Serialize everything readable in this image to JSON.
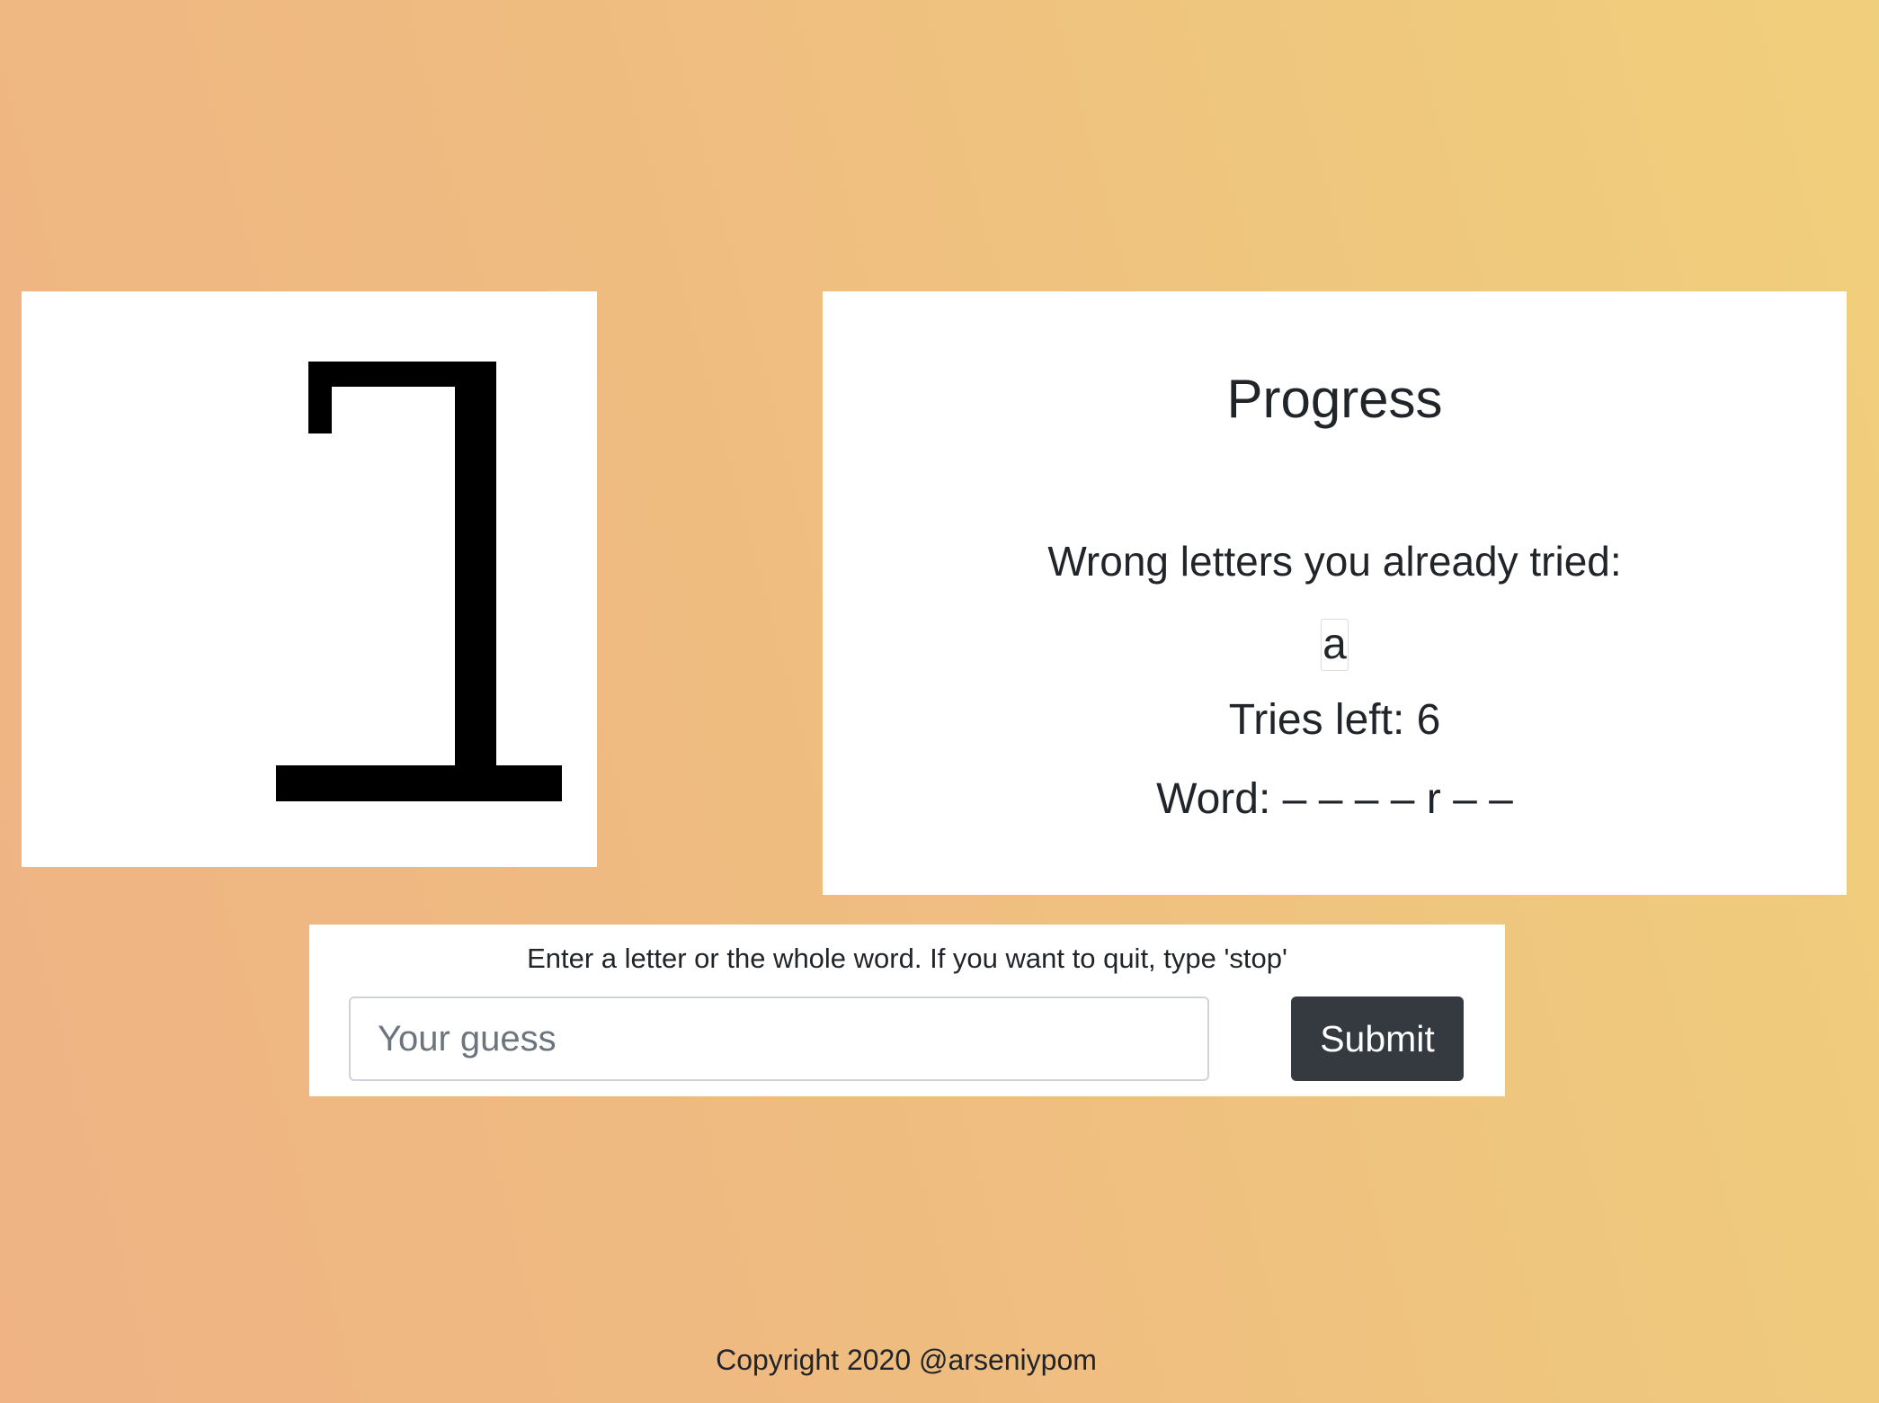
{
  "progress": {
    "title": "Progress",
    "wrong_letters_label": "Wrong letters you already tried:",
    "wrong_letters": [
      "a"
    ],
    "tries_left": "Tries left: 6",
    "word": "Word: – – – – r – –"
  },
  "guess": {
    "hint": "Enter a letter or the whole word. If you want to quit, type 'stop'",
    "placeholder": "Your guess",
    "value": "",
    "submit_label": "Submit"
  },
  "footer": {
    "copyright": "Copyright 2020 @arseniypom"
  },
  "colors": {
    "card_background": "#ffffff",
    "gallows": "#000000",
    "submit_button": "#343a40",
    "text": "#212529",
    "background_gradient": [
      "#efb384",
      "#f0cf7c"
    ]
  }
}
